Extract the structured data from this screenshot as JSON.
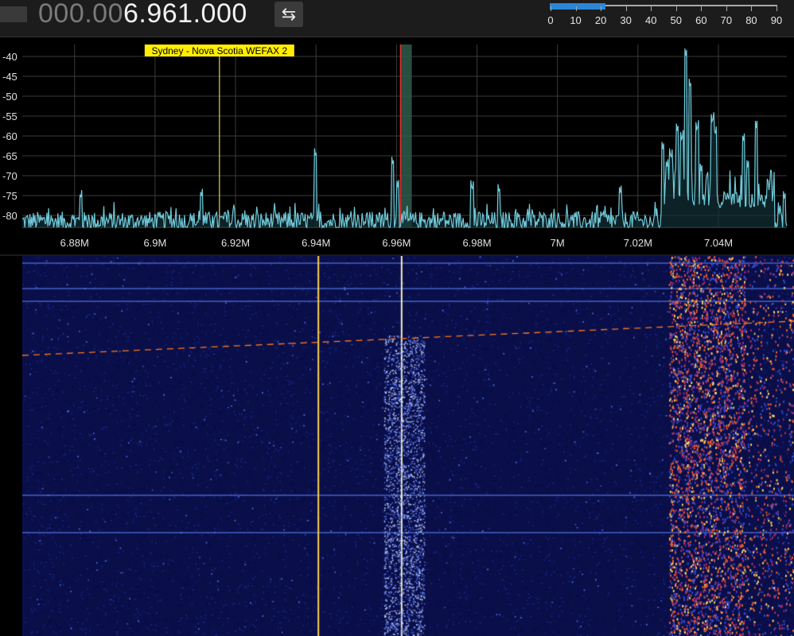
{
  "frequency": {
    "dim_prefix": "000.00",
    "bright_part": "6.961.000"
  },
  "swap_button": {
    "glyph": "⇆",
    "icon": "swap-arrows-icon"
  },
  "zoom": {
    "labels": [
      "0",
      "10",
      "20",
      "30",
      "40",
      "50",
      "60",
      "70",
      "80",
      "90"
    ],
    "min": 0,
    "max": 90,
    "value": 22,
    "fill_color": "#2b86d6"
  },
  "spectrum": {
    "y_labels": [
      "-40",
      "-45",
      "-50",
      "-55",
      "-60",
      "-65",
      "-70",
      "-75",
      "-80"
    ],
    "x_labels": [
      "6.88M",
      "6.9M",
      "6.92M",
      "6.94M",
      "6.96M",
      "6.98M",
      "7M",
      "7.02M",
      "7.04M"
    ],
    "bookmark": {
      "label": "Sydney - Nova Scotia WEFAX 2",
      "color": "#ffee00"
    },
    "trace_color": "#6fc8d8",
    "passband_color": "#2f5c4c",
    "tuned_line_color": "#e03030"
  },
  "chart_data": {
    "type": "line",
    "xlabel": "",
    "ylabel": "",
    "xlim": [
      6.867,
      7.057
    ],
    "ylim": [
      -83,
      -37
    ],
    "x_ticks": [
      6.88,
      6.9,
      6.92,
      6.94,
      6.96,
      6.98,
      7.0,
      7.02,
      7.04
    ],
    "y_ticks": [
      -40,
      -45,
      -50,
      -55,
      -60,
      -65,
      -70,
      -75,
      -80
    ],
    "bookmark_freq": 6.916,
    "tuned_freq": 6.961,
    "passband": [
      6.961,
      6.9638
    ],
    "noise_floor": -80,
    "peaks": [
      {
        "x": 6.8815,
        "y": -76
      },
      {
        "x": 6.9115,
        "y": -75.5
      },
      {
        "x": 6.9399,
        "y": -65.5
      },
      {
        "x": 6.9591,
        "y": -67.5
      },
      {
        "x": 6.9603,
        "y": -73
      },
      {
        "x": 6.9788,
        "y": -74
      },
      {
        "x": 6.9855,
        "y": -74.5
      },
      {
        "x": 7.0156,
        "y": -74.5
      },
      {
        "x": 7.0262,
        "y": -63.5
      },
      {
        "x": 7.0272,
        "y": -68
      },
      {
        "x": 7.0282,
        "y": -66
      },
      {
        "x": 7.0298,
        "y": -59
      },
      {
        "x": 7.0309,
        "y": -61.5
      },
      {
        "x": 7.0319,
        "y": -40
      },
      {
        "x": 7.033,
        "y": -48
      },
      {
        "x": 7.0347,
        "y": -59
      },
      {
        "x": 7.0357,
        "y": -69
      },
      {
        "x": 7.0385,
        "y": -57
      },
      {
        "x": 7.0392,
        "y": -60
      },
      {
        "x": 7.0462,
        "y": -61.5
      },
      {
        "x": 7.0494,
        "y": -58
      },
      {
        "x": 7.0473,
        "y": -68
      },
      {
        "x": 7.0524,
        "y": -75
      },
      {
        "x": 7.0564,
        "y": -76
      }
    ]
  },
  "waterfall": {
    "background": "#0a0f4a",
    "carriers": [
      {
        "x": 6.9399,
        "color": "#ffd24a"
      },
      {
        "x": 6.9604,
        "color": "#f4f0c0"
      }
    ],
    "busy_band": [
      7.0262,
      7.057
    ],
    "sweep_color": "#ff7a1a"
  }
}
